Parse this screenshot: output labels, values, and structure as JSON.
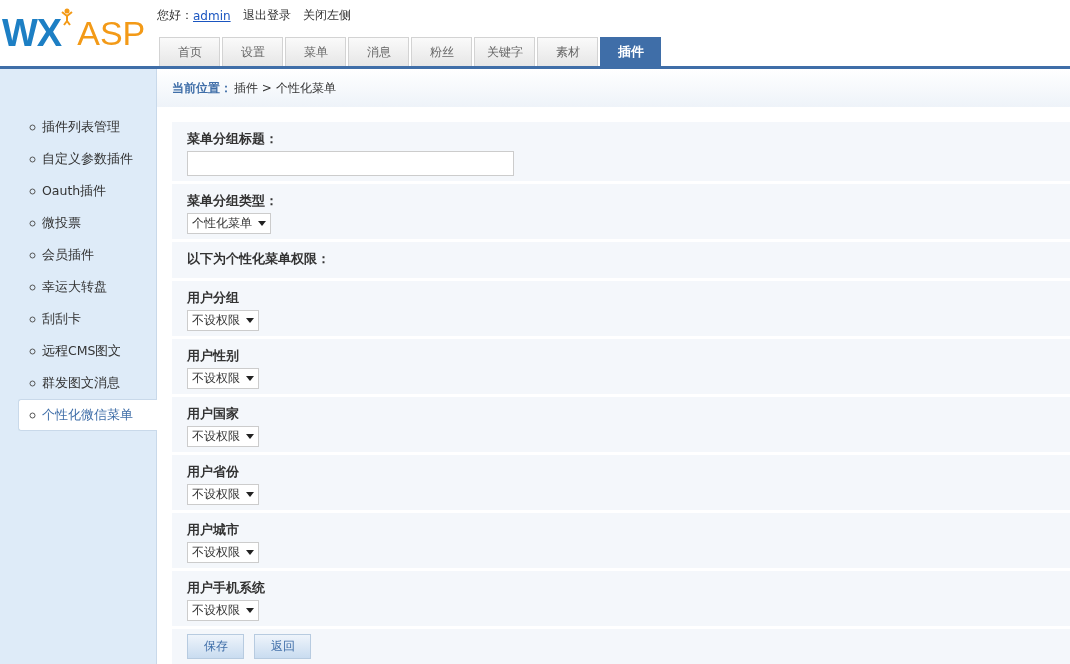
{
  "header": {
    "logo": {
      "part_1": "WX",
      "part_2": "ASP"
    },
    "greeting": "您好：",
    "user": "admin",
    "links": [
      "退出登录",
      "关闭左侧"
    ]
  },
  "tabs": [
    {
      "label": "首页",
      "selected": false
    },
    {
      "label": "设置",
      "selected": false
    },
    {
      "label": "菜单",
      "selected": false
    },
    {
      "label": "消息",
      "selected": false
    },
    {
      "label": "粉丝",
      "selected": false
    },
    {
      "label": "关键字",
      "selected": false
    },
    {
      "label": "素材",
      "selected": false
    },
    {
      "label": "插件",
      "selected": true
    }
  ],
  "sidebar": {
    "items": [
      {
        "label": "插件列表管理",
        "selected": false
      },
      {
        "label": "自定义参数插件",
        "selected": false
      },
      {
        "label": "Oauth插件",
        "selected": false
      },
      {
        "label": "微投票",
        "selected": false
      },
      {
        "label": "会员插件",
        "selected": false
      },
      {
        "label": "幸运大转盘",
        "selected": false
      },
      {
        "label": "刮刮卡",
        "selected": false
      },
      {
        "label": "远程CMS图文",
        "selected": false
      },
      {
        "label": "群发图文消息",
        "selected": false
      },
      {
        "label": "个性化微信菜单",
        "selected": true
      }
    ]
  },
  "breadcrumb": {
    "label": "当前位置：",
    "path": "插件 > 个性化菜单"
  },
  "form": {
    "rows": [
      {
        "kind": "text",
        "label": "菜单分组标题："
      },
      {
        "kind": "select",
        "label": "菜单分组类型：",
        "value": "个性化菜单"
      },
      {
        "kind": "note",
        "label": "以下为个性化菜单权限："
      },
      {
        "kind": "select",
        "label": "用户分组",
        "value": "不设权限"
      },
      {
        "kind": "select",
        "label": "用户性别",
        "value": "不设权限"
      },
      {
        "kind": "select",
        "label": "用户国家",
        "value": "不设权限"
      },
      {
        "kind": "select",
        "label": "用户省份",
        "value": "不设权限"
      },
      {
        "kind": "select",
        "label": "用户城市",
        "value": "不设权限"
      },
      {
        "kind": "select",
        "label": "用户手机系统",
        "value": "不设权限"
      }
    ],
    "buttons": [
      "保存",
      "返回"
    ]
  }
}
